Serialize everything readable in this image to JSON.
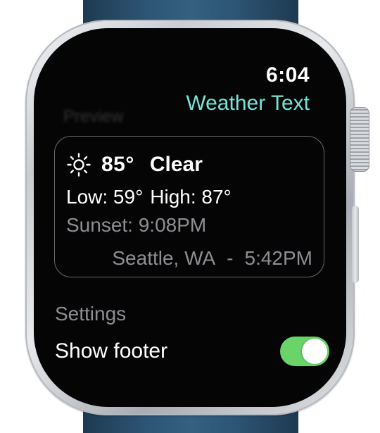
{
  "status": {
    "time": "6:04"
  },
  "header": {
    "title": "Weather Text",
    "section_ghost": "Preview"
  },
  "preview": {
    "icon": "sun-icon",
    "temperature": "85°",
    "condition": "Clear",
    "low": "Low: 59°",
    "high": "High: 87°",
    "sunset": "Sunset: 9:08PM",
    "location": "Seattle, WA",
    "separator": "-",
    "local_time": "5:42PM"
  },
  "settings": {
    "label": "Settings",
    "show_footer_label": "Show footer",
    "show_footer_on": true
  },
  "colors": {
    "accent_title": "#78e3d8",
    "toggle_on": "#6ad46a",
    "secondary_text": "#8e8e93",
    "band": "#2d5575"
  }
}
